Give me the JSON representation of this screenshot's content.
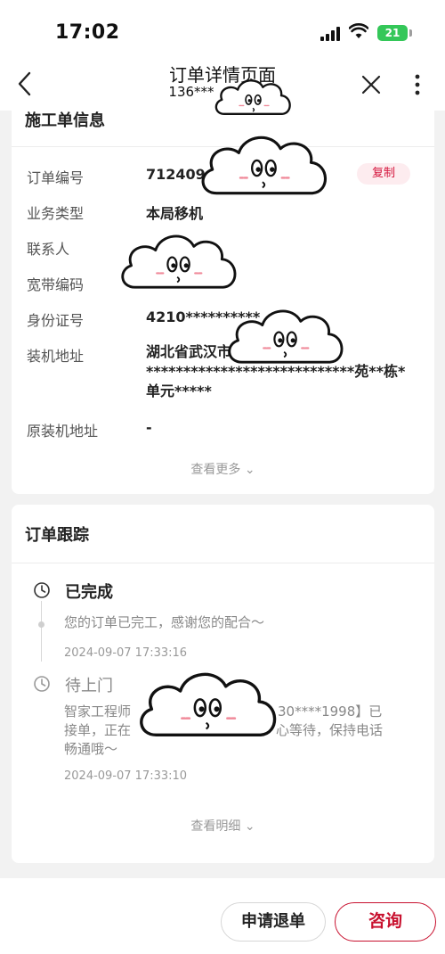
{
  "status_bar": {
    "time": "17:02",
    "battery": "21"
  },
  "nav": {
    "title": "订单详情页面",
    "subtitle": "136***"
  },
  "info_card": {
    "title": "施工单信息",
    "copy_label": "复制",
    "rows": [
      {
        "label": "订单编号",
        "value": "712409"
      },
      {
        "label": "业务类型",
        "value": "本局移机"
      },
      {
        "label": "联系人",
        "value": ""
      },
      {
        "label": "宽带编码",
        "value": ""
      },
      {
        "label": "身份证号",
        "value": "4210**********"
      },
      {
        "label": "装机地址",
        "value": "湖北省武汉市"
      },
      {
        "label": "原装机地址",
        "value": "-"
      }
    ],
    "address_line2": "****************************苑**栋*",
    "address_line3": "单元*****",
    "view_more": "查看更多 ⌄"
  },
  "tracking": {
    "title": "订单跟踪",
    "items": [
      {
        "status": "已完成",
        "desc": "您的订单已完工，感谢您的配合～",
        "time": "2024-09-07 17:33:16"
      },
      {
        "status": "待上门",
        "desc_line1": "智家工程师",
        "desc_line1_right": "30****1998】已",
        "desc_line2": "接单，正在",
        "desc_line2_right": "心等待，保持电话",
        "desc_line3": "畅通哦～",
        "time": "2024-09-07 17:33:10"
      }
    ],
    "view_detail": "查看明细 ⌄"
  },
  "actions": {
    "refund": "申请退单",
    "consult": "咨询"
  },
  "colors": {
    "accent": "#c8102e",
    "copy_bg": "#fdecef",
    "battery": "#34c759"
  }
}
